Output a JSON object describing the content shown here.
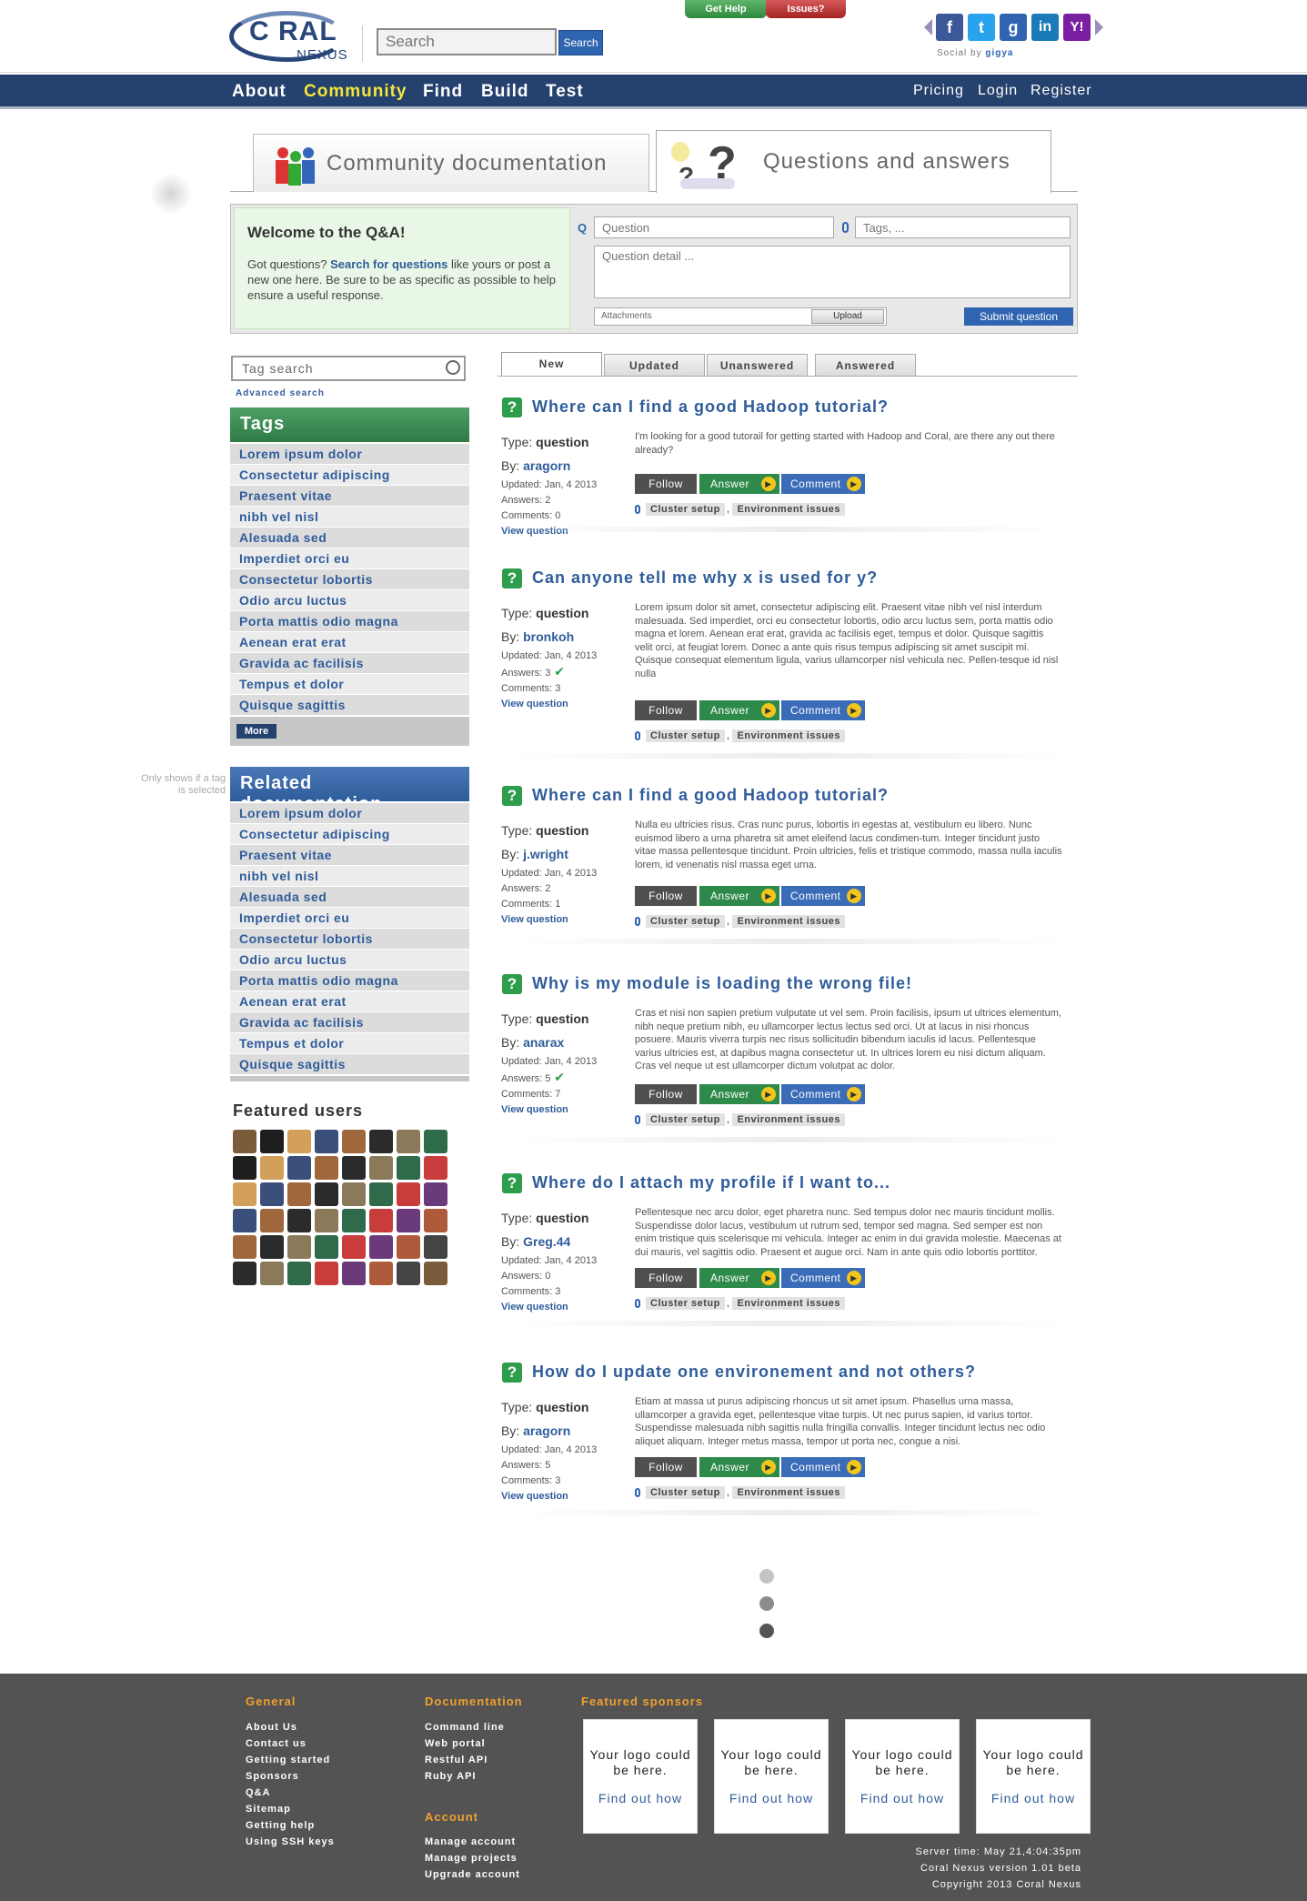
{
  "header": {
    "logo_word": "C   RAL",
    "logo_sub": "NEXUS",
    "search_placeholder": "Search",
    "search_button": "Search",
    "get_help": "Get Help",
    "issues": "Issues?",
    "social_by": "Social by",
    "social_brand": "gigya",
    "social_icons": [
      "facebook-icon",
      "twitter-icon",
      "google-icon",
      "linkedin-icon",
      "yahoo-icon"
    ]
  },
  "nav": {
    "left": [
      "About",
      "Community",
      "Find",
      "Build",
      "Test"
    ],
    "active": "Community",
    "right": [
      "Pricing",
      "Login",
      "Register"
    ]
  },
  "section_tabs": [
    "Community documentation",
    "Questions and answers"
  ],
  "ask": {
    "welcome_title": "Welcome to the Q&A!",
    "welcome_pre": "Got questions? ",
    "welcome_link": "Search for questions",
    "welcome_post": " like yours or post a new one here.  Be sure to be as specific as possible to help ensure a useful response.",
    "q_label": "Q",
    "question_placeholder": "Question",
    "tags_placeholder": "Tags, ...",
    "detail_placeholder": "Question detail ...",
    "attachments": "Attachments",
    "upload": "Upload",
    "submit": "Submit question"
  },
  "sidebar": {
    "tag_search": "Tag search",
    "advanced_search": "Advanced search",
    "tags_title": "Tags",
    "tags": [
      "Lorem ipsum dolor",
      "Consectetur adipiscing",
      "Praesent vitae",
      "nibh vel nisl",
      "Alesuada sed",
      "Imperdiet orci eu",
      "Consectetur lobortis",
      "Odio arcu luctus",
      "Porta mattis odio magna",
      "Aenean erat erat",
      "Gravida ac facilisis",
      "Tempus et dolor",
      "Quisque sagittis"
    ],
    "more": "More",
    "note": "Only shows if a tag is selected",
    "related_title": "Related documentation",
    "related": [
      "Lorem ipsum dolor",
      "Consectetur adipiscing",
      "Praesent vitae",
      "nibh vel nisl",
      "Alesuada sed",
      "Imperdiet orci eu",
      "Consectetur lobortis",
      "Odio arcu luctus",
      "Porta mattis odio magna",
      "Aenean erat erat",
      "Gravida ac facilisis",
      "Tempus et dolor",
      "Quisque sagittis"
    ],
    "featured_title": "Featured users"
  },
  "question_tabs": [
    "New",
    "Updated",
    "Unanswered",
    "Answered"
  ],
  "questions": [
    {
      "title": "Where can I find a good Hadoop tutorial?",
      "type": "question",
      "by": "aragorn",
      "updated": "Updated: Jan, 4 2013",
      "answers": "Answers: 2",
      "comments": "Comments: 0",
      "body": "I'm looking for a good tutorail for getting started with Hadoop and Coral, are there any out there already?"
    },
    {
      "title": "Can anyone tell me why x is used for y?",
      "type": "question",
      "by": "bronkoh",
      "updated": "Updated: Jan, 4 2013",
      "answers": "Answers: 3",
      "comments": "Comments: 3",
      "body": "Lorem ipsum dolor sit amet, consectetur adipiscing elit. Praesent vitae nibh vel nisl interdum malesuada. Sed imperdiet, orci eu consectetur lobortis, odio arcu luctus sem, porta mattis odio magna et lorem. Aenean erat erat, gravida ac facilisis eget, tempus et dolor. Quisque sagittis velit orci, at feugiat lorem. Donec a ante quis risus tempus adipiscing sit amet suscipit mi. Quisque consequat elementum ligula, varius ullamcorper nisl vehicula nec. Pellen-tesque id nisl nulla"
    },
    {
      "title": "Where can I find a good Hadoop tutorial?",
      "type": "question",
      "by": "j.wright",
      "updated": "Updated: Jan, 4 2013",
      "answers": "Answers: 2",
      "comments": "Comments: 1",
      "body": "Nulla eu ultricies risus. Cras nunc purus, lobortis in egestas at, vestibulum eu libero. Nunc euismod libero a urna pharetra sit amet eleifend lacus condimen-tum. Integer tincidunt justo vitae massa pellentesque tincidunt. Proin ultricies, felis et tristique commodo, massa nulla iaculis lorem, id venenatis nisl massa eget urna."
    },
    {
      "title": "Why is my module is loading the wrong file!",
      "type": "question",
      "by": "anarax",
      "updated": "Updated: Jan, 4 2013",
      "answers": "Answers: 5",
      "comments": "Comments: 7",
      "body": "Cras et nisi non sapien pretium vulputate ut vel sem. Proin facilisis, ipsum ut ultrices elementum, nibh neque pretium nibh, eu ullamcorper lectus lectus sed orci. Ut at lacus in nisi rhoncus posuere. Mauris viverra turpis nec risus sollicitudin bibendum iaculis id lacus. Pellentesque varius ultricies est, at dapibus magna consectetur ut. In ultrices lorem eu nisi dictum aliquam. Cras vel neque ut est ullamcorper dictum volutpat ac dolor."
    },
    {
      "title": "Where do I attach my profile if I want to...",
      "type": "question",
      "by": "Greg.44",
      "updated": "Updated: Jan, 4 2013",
      "answers": "Answers: 0",
      "comments": "Comments: 3",
      "body": "Pellentesque nec arcu dolor, eget pharetra nunc. Sed tempus dolor nec mauris tincidunt mollis. Suspendisse dolor lacus, vestibulum ut rutrum sed, tempor sed magna. Sed semper est non enim tristique quis scelerisque mi vehicula. Integer ac enim in dui gravida molestie. Maecenas at dui mauris, vel sagittis odio. Praesent et augue orci. Nam in ante quis odio lobortis porttitor."
    },
    {
      "title": "How do I update one environement and not others?",
      "type": "question",
      "by": "aragorn",
      "updated": "Updated: Jan, 4 2013",
      "answers": "Answers: 5",
      "comments": "Comments: 3",
      "body": "Etiam at massa ut purus adipiscing rhoncus ut sit amet ipsum. Phasellus urna massa, ullamcorper a gravida eget, pellentesque vitae turpis. Ut nec purus sapien, id varius tortor. Suspendisse malesuada nibh sagittis nulla fringilla convallis. Integer tincidunt lectus nec odio aliquet aliquam. Integer metus massa, tempor ut porta nec, congue a nisi."
    }
  ],
  "q_labels": {
    "type": "Type:",
    "by": "By:",
    "view": "View question",
    "follow": "Follow",
    "answer": "Answer",
    "comment": "Comment",
    "tag1": "Cluster setup",
    "tag2": "Environment issues"
  },
  "footer": {
    "general_title": "General",
    "general": [
      "About Us",
      "Contact us",
      "Getting started",
      "Sponsors",
      "Q&A",
      "Sitemap",
      "Getting help",
      "Using SSH keys"
    ],
    "docs_title": "Documentation",
    "docs": [
      "Command line",
      "Web portal",
      "Restful API",
      "Ruby API"
    ],
    "account_title": "Account",
    "account": [
      "Manage account",
      "Manage projects",
      "Upgrade account"
    ],
    "sponsors_title": "Featured sponsors",
    "sponsor_text": "Your logo could be here.",
    "sponsor_link": "Find out how",
    "server_time": "Server time: May 21,4:04:35pm",
    "version": "Coral Nexus version 1.01 beta",
    "copyright": "Copyright 2013 Coral Nexus"
  },
  "colors": {
    "nav_bg": "#25416d",
    "accent_blue": "#2f5c9a",
    "green": "#2e9d4c",
    "orange": "#f0a030",
    "footer_bg": "#535353",
    "active_nav": "#f5e63c"
  }
}
